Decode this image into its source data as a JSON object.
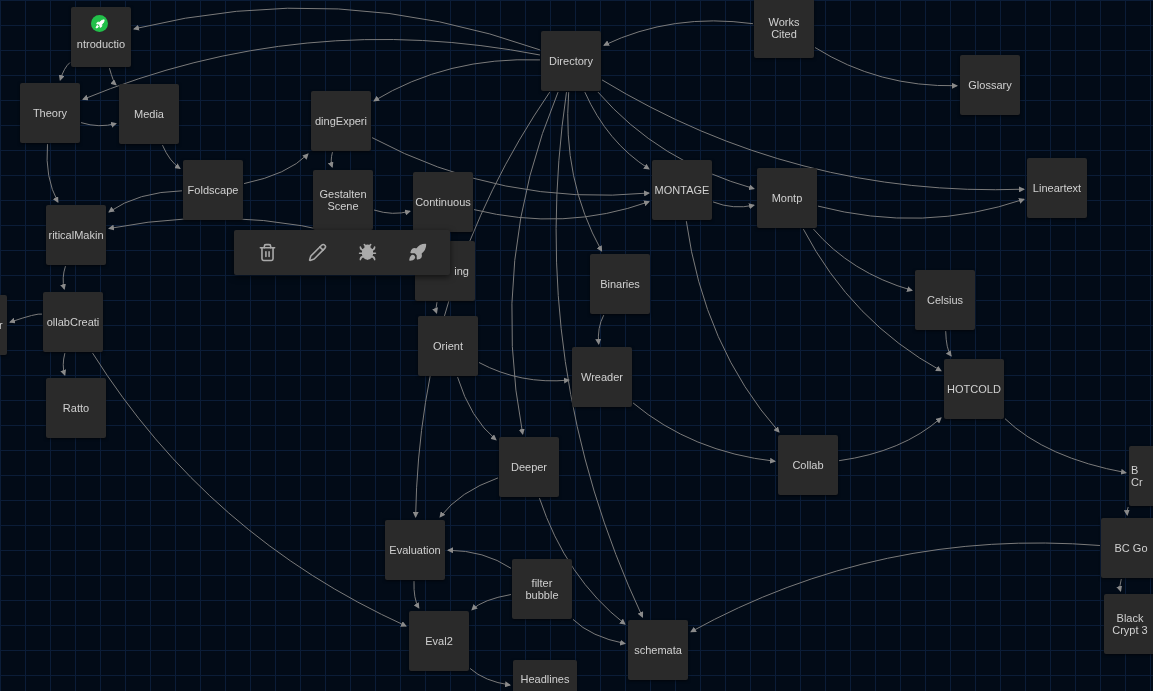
{
  "passages": [
    {
      "title": "ntroductio",
      "start": true
    },
    {
      "title": "Theory",
      "start": false
    },
    {
      "title": "Media",
      "start": false
    },
    {
      "title": "dingExperi",
      "start": false
    },
    {
      "title": "Foldscape",
      "start": false
    },
    {
      "title": "Gestalten Scene",
      "start": false
    },
    {
      "title": "Continuous",
      "start": false
    },
    {
      "title": "riticalMakin",
      "start": false
    },
    {
      "title": "r",
      "start": false
    },
    {
      "title": "ollabCreati",
      "start": false
    },
    {
      "title": "Ratto",
      "start": false
    },
    {
      "title": "ing",
      "start": false
    },
    {
      "title": "Orient",
      "start": false
    },
    {
      "title": "Directory",
      "start": false
    },
    {
      "title": "Works Cited",
      "start": false
    },
    {
      "title": "Glossary",
      "start": false
    },
    {
      "title": "MONTAGE",
      "start": false
    },
    {
      "title": "Montp",
      "start": false
    },
    {
      "title": "Lineartext",
      "start": false
    },
    {
      "title": "Binaries",
      "start": false
    },
    {
      "title": "Wreader",
      "start": false
    },
    {
      "title": "Celsius",
      "start": false
    },
    {
      "title": "HOTCOLD",
      "start": false
    },
    {
      "title": "Deeper",
      "start": false
    },
    {
      "title": "Collab",
      "start": false
    },
    {
      "title": "Evaluation",
      "start": false
    },
    {
      "title": "filter bubble",
      "start": false
    },
    {
      "title": "Eval2",
      "start": false
    },
    {
      "title": "schemata",
      "start": false
    },
    {
      "title": "Headlines",
      "start": false
    },
    {
      "title": "B Cr",
      "start": false
    },
    {
      "title": "BC Go",
      "start": false
    },
    {
      "title": "Black Crypt 3",
      "start": false
    }
  ],
  "toolbar": {
    "buttons": [
      {
        "kind": "delete"
      },
      {
        "kind": "edit"
      },
      {
        "kind": "test"
      },
      {
        "kind": "play"
      }
    ]
  }
}
